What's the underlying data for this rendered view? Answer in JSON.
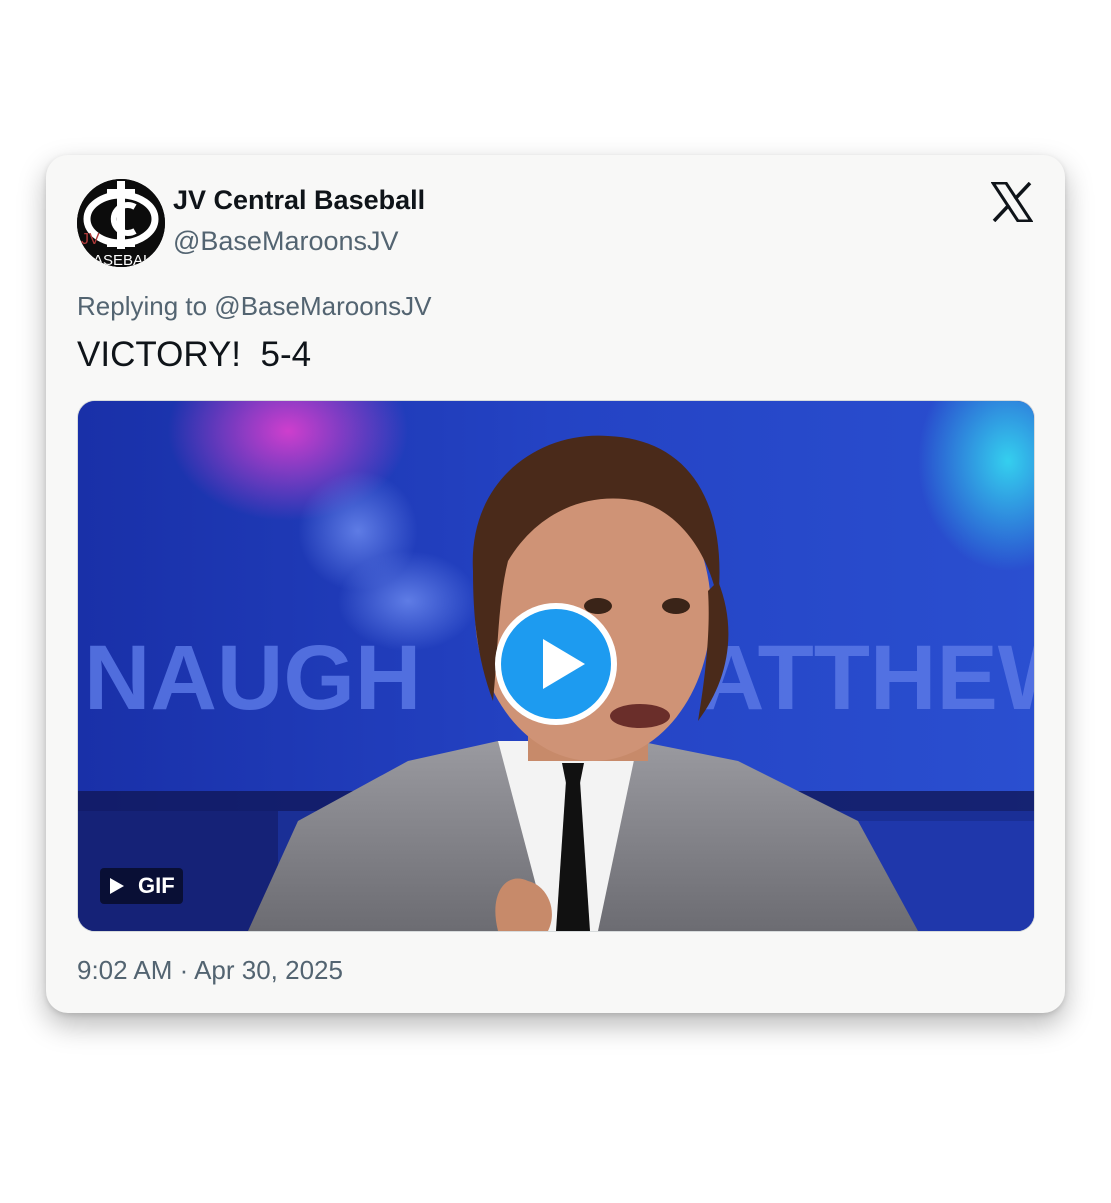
{
  "tweet": {
    "display_name": "JV Central Baseball",
    "handle": "@BaseMaroonsJV",
    "replying_to": "Replying to @BaseMaroonsJV",
    "text": "VICTORY!  5-4",
    "timestamp": "9:02 AM · Apr 30, 2025"
  },
  "avatar": {
    "logo_text": "JV",
    "logo_subtext": "BASEBALL"
  },
  "media": {
    "type": "gif",
    "badge_label": "GIF",
    "background_text_left": "NAUGH",
    "background_text_right": "ATTHEW",
    "play_icon": "play-icon"
  },
  "brand": {
    "icon": "x-logo-icon",
    "accent_color": "#1d9bf0"
  }
}
